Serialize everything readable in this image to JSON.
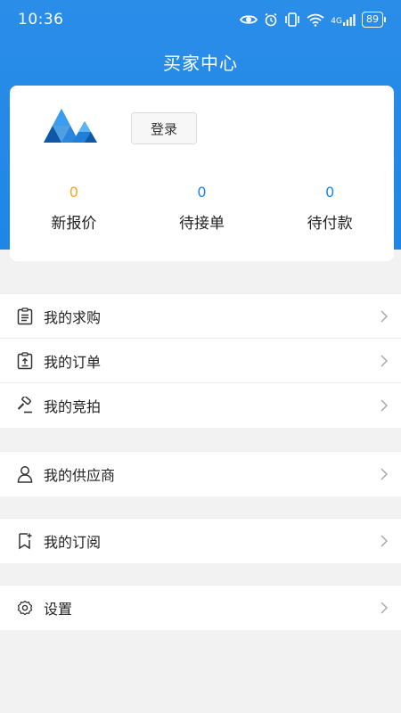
{
  "status_bar": {
    "time": "10:36",
    "network": "4G",
    "battery": "89"
  },
  "page_title": "买家中心",
  "account": {
    "login_label": "登录"
  },
  "stats": [
    {
      "value": "0",
      "label": "新报价",
      "color": "#f4a72b"
    },
    {
      "value": "0",
      "label": "待接单",
      "color": "#1f86e6"
    },
    {
      "value": "0",
      "label": "待付款",
      "color": "#1f86e6"
    }
  ],
  "menu": {
    "purchases": {
      "label": "我的求购",
      "icon": "clipboard-list-icon"
    },
    "orders": {
      "label": "我的订单",
      "icon": "clipboard-upload-icon"
    },
    "auctions": {
      "label": "我的竞拍",
      "icon": "gavel-icon"
    },
    "suppliers": {
      "label": "我的供应商",
      "icon": "person-icon"
    },
    "subscriptions": {
      "label": "我的订阅",
      "icon": "bookmark-icon"
    },
    "settings": {
      "label": "设置",
      "icon": "gear-icon"
    }
  },
  "colors": {
    "header": "#1f86e6",
    "accent_orange": "#f4a72b",
    "background": "#f2f2f2"
  }
}
